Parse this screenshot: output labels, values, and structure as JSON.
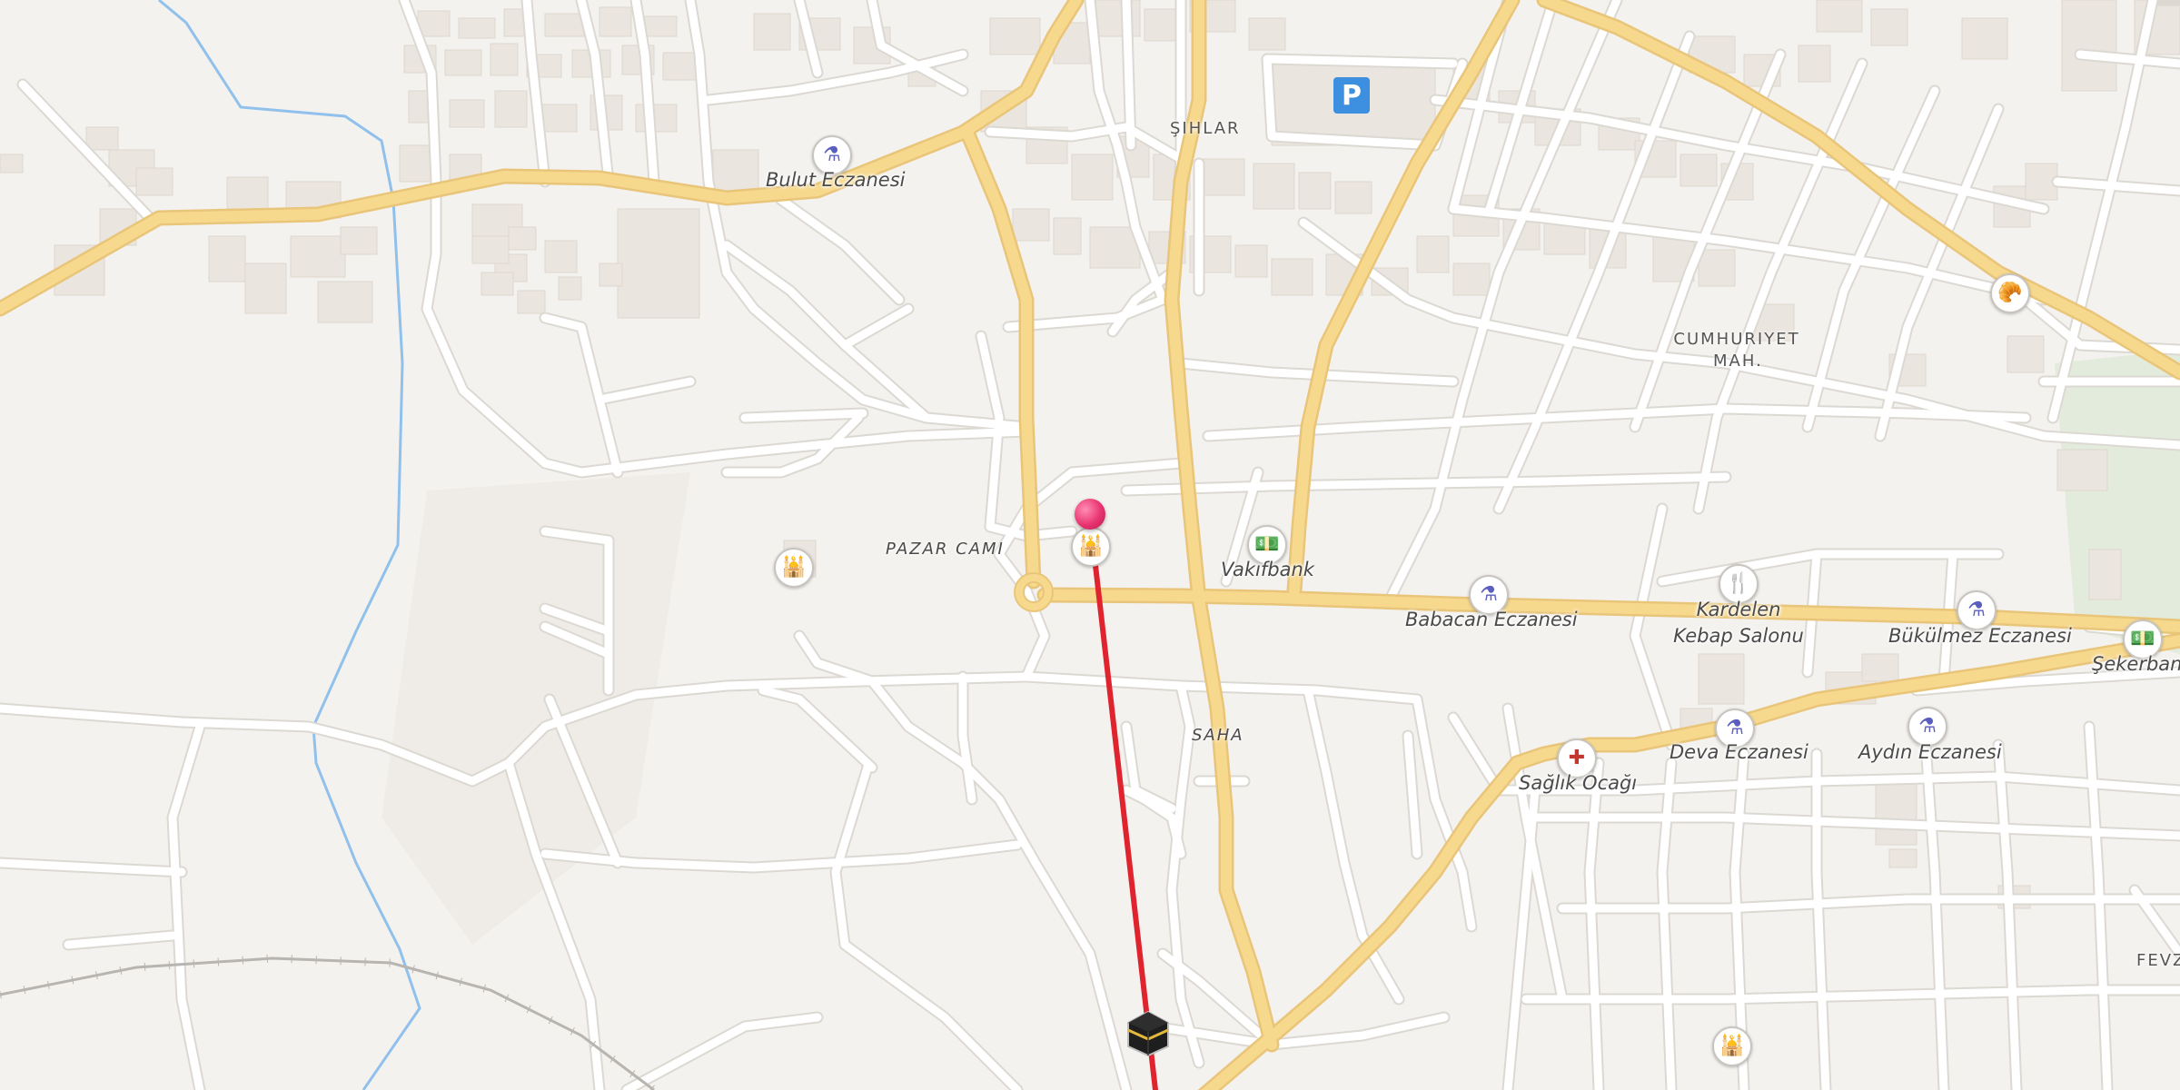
{
  "map": {
    "colors": {
      "background": "#f4f2ef",
      "major_road": "#f7d98e",
      "major_road_casing": "#e9c57a",
      "minor_road": "#ffffff",
      "minor_road_casing": "#dcd8d2",
      "building": "#ebe5df",
      "water": "#90c0ec",
      "park": "#e3ecdc",
      "route_line": "#e0242f",
      "pin": "#e8336f"
    },
    "district_labels": [
      {
        "text": "ŞIHLAR"
      },
      {
        "text_line1": "CUMHURIYET",
        "text_line2": "MAH."
      },
      {
        "text": "FEVZ"
      }
    ],
    "street_labels": [
      {
        "text": "PAZAR CAMI"
      },
      {
        "text": "SAHA"
      }
    ],
    "pois": [
      {
        "name": "Bulut Eczanesi",
        "type": "pharmacy",
        "icon": "pharmacy-icon"
      },
      {
        "name": "Vakıfbank",
        "type": "bank",
        "icon": "bank-icon"
      },
      {
        "name": "Babacan Eczanesi",
        "type": "pharmacy",
        "icon": "pharmacy-icon"
      },
      {
        "name_line1": "Kardelen",
        "name_line2": "Kebap Salonu",
        "type": "restaurant",
        "icon": "fork-knife-icon"
      },
      {
        "name": "Bükülmez Eczanesi",
        "type": "pharmacy",
        "icon": "pharmacy-icon"
      },
      {
        "name": "Şekerbank",
        "type": "bank",
        "icon": "bank-icon"
      },
      {
        "name": "Sağlık Ocağı",
        "type": "clinic",
        "icon": "medical-cross-icon"
      },
      {
        "name": "Deva Eczanesi",
        "type": "pharmacy",
        "icon": "pharmacy-icon"
      },
      {
        "name": "Aydın Eczanesi",
        "type": "pharmacy",
        "icon": "pharmacy-icon"
      }
    ],
    "unlabeled_pois": [
      {
        "type": "mosque",
        "icon": "mosque-icon"
      },
      {
        "type": "mosque",
        "icon": "mosque-icon"
      },
      {
        "type": "mosque",
        "icon": "mosque-icon"
      },
      {
        "type": "bakery",
        "icon": "croissant-icon"
      }
    ],
    "parking_label": "P",
    "markers": {
      "location_pin": {
        "icon": "location-pin-icon"
      },
      "kaaba": {
        "icon": "kaaba-icon"
      }
    }
  }
}
